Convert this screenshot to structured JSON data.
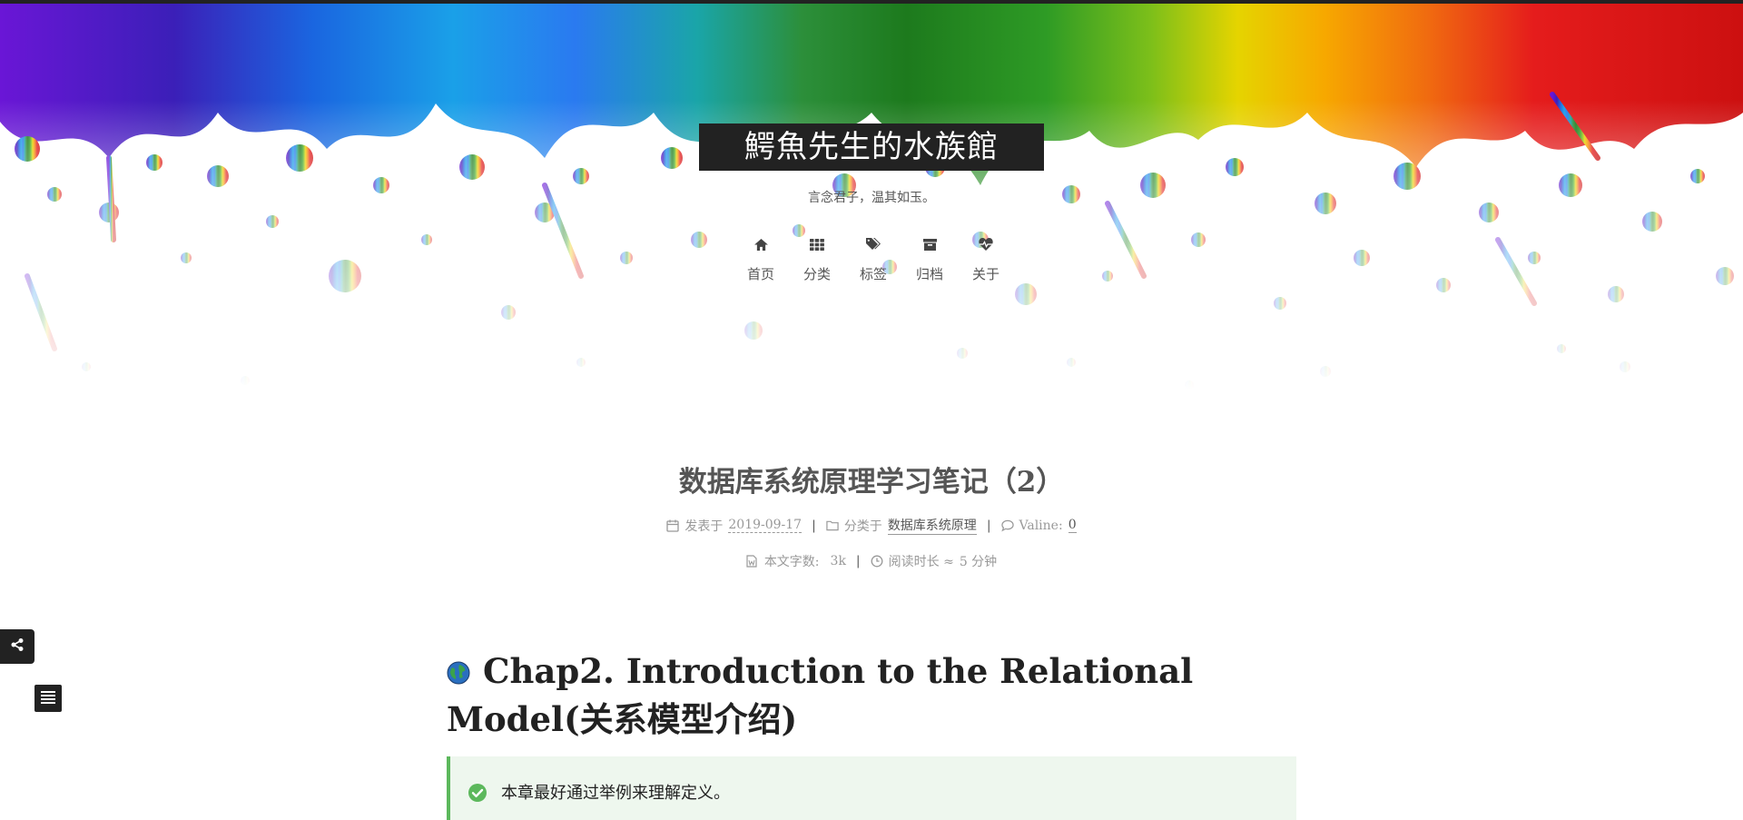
{
  "site": {
    "title": "鰐魚先生的水族館",
    "subtitle": "言念君子，温其如玉。"
  },
  "menu": {
    "items": [
      {
        "label": "首页",
        "icon": "home-icon"
      },
      {
        "label": "分类",
        "icon": "th-icon"
      },
      {
        "label": "标签",
        "icon": "tags-icon"
      },
      {
        "label": "归档",
        "icon": "archive-icon"
      },
      {
        "label": "关于",
        "icon": "heartbeat-icon"
      }
    ]
  },
  "post": {
    "title": "数据库系统原理学习笔记（2）",
    "meta": {
      "posted_label": "发表于",
      "posted_date": "2019-09-17",
      "category_label": "分类于",
      "category": "数据库系统原理",
      "comments_label": "Valine:",
      "comments_count": "0",
      "wordcount_label": "本文字数:",
      "wordcount": "3k",
      "readtime_label": "阅读时长 ≈",
      "readtime": "5 分钟"
    },
    "heading": "Chap2. Introduction to the Relational Model(关系模型介绍)",
    "note": "本章最好通过举例来理解定义。"
  },
  "colors": {
    "accent_dark": "#222222",
    "note_bg": "#eef7ee",
    "note_border": "#5cb85c"
  }
}
